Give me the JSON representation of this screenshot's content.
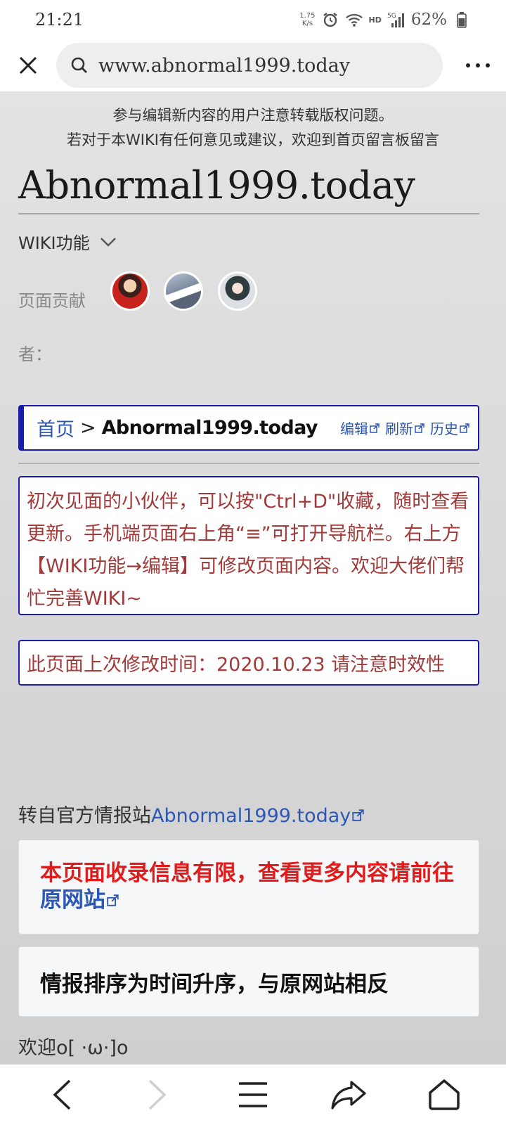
{
  "status_bar": {
    "time": "21:21",
    "net_speed_value": "1.75",
    "net_speed_unit": "K/s",
    "network_label": "HD",
    "signal_label": "5G",
    "battery": "62%",
    "icons": [
      "alarm-icon",
      "wifi-icon",
      "signal-icon",
      "battery-icon"
    ]
  },
  "browser": {
    "url": "www.abnormal1999.today",
    "icons": [
      "close-icon",
      "search-icon",
      "more-icon"
    ]
  },
  "page": {
    "notice_line1": "参与编辑新内容的用户注意转载版权问题。",
    "notice_line2": "若对于本WIKI有任何意见或建议，欢迎到首页留言板留言",
    "title": "Abnormal1999.today",
    "wiki_func_label": "WIKI功能",
    "contributors_label": "页面贡献",
    "contributors_label_suffix": "者：",
    "breadcrumb": {
      "home": "首页",
      "separator": ">",
      "current": "Abnormal1999.today",
      "actions": [
        "编辑",
        "刷新",
        "历史"
      ]
    },
    "tip_text": "初次见面的小伙伴，可以按\"Ctrl+D\"收藏，随时查看更新。手机端页面右上角“≡”可打开导航栏。右上方【WIKI功能→编辑】可修改页面内容。欢迎大佬们帮忙完善WIKI~",
    "update_notice": "此页面上次修改时间：2020.10.23 请注意时效性",
    "source_prefix": "转自官方情报站",
    "source_link": "Abnormal1999.today",
    "limited_info_text": "本页面收录信息有限，查看更多内容请前往",
    "limited_info_link": "原网站",
    "order_note": "情报排序为时间升序，与原网站相反",
    "welcome_partial": "欢迎o[ ·ω·]o"
  },
  "colors": {
    "link": "#2c57b5",
    "box_border": "#1b1ba8",
    "tip_text": "#a33a3a",
    "alert_red": "#e01b1b"
  },
  "bottom_nav": [
    "back-icon",
    "forward-icon",
    "menu-icon",
    "share-icon",
    "home-icon"
  ]
}
